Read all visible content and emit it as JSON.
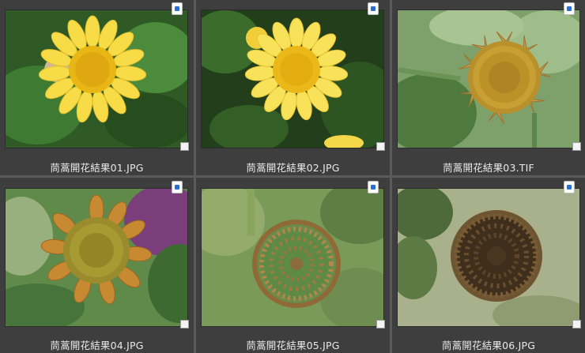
{
  "thumbnails": [
    {
      "filename": "茼蒿開花結果01.JPG",
      "file_icon": "image-file-icon",
      "image": "yellow-daisy-flower-open"
    },
    {
      "filename": "茼蒿開花結果02.JPG",
      "file_icon": "image-file-icon",
      "image": "yellow-daisy-flower-open"
    },
    {
      "filename": "茼蒿開花結果03.TIF",
      "file_icon": "image-file-icon",
      "image": "wilting-flower-head"
    },
    {
      "filename": "茼蒿開花結果04.JPG",
      "file_icon": "image-file-icon",
      "image": "drying-flower-head"
    },
    {
      "filename": "茼蒿開花結果05.JPG",
      "file_icon": "image-file-icon",
      "image": "green-seed-head"
    },
    {
      "filename": "茼蒿開花結果06.JPG",
      "file_icon": "image-file-icon",
      "image": "dried-brown-seed-head"
    }
  ]
}
